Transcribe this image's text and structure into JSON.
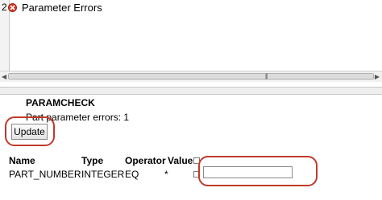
{
  "error_list": {
    "rows": [
      {
        "number": "2",
        "icon": "error-icon",
        "text": "Parameter Errors"
      }
    ]
  },
  "panel": {
    "title": "PARAMCHECK",
    "errors_label": "Part parameter errors: 1",
    "update_label": "Update"
  },
  "table": {
    "headers": [
      "Name",
      "Type",
      "Operator",
      "Value"
    ],
    "rows": [
      {
        "name": "PART_NUMBER",
        "type": "INTEGER",
        "operator": "EQ",
        "required": "*",
        "value": ""
      }
    ]
  },
  "colors": {
    "highlight": "#c0392b",
    "error": "#d83a2a"
  }
}
